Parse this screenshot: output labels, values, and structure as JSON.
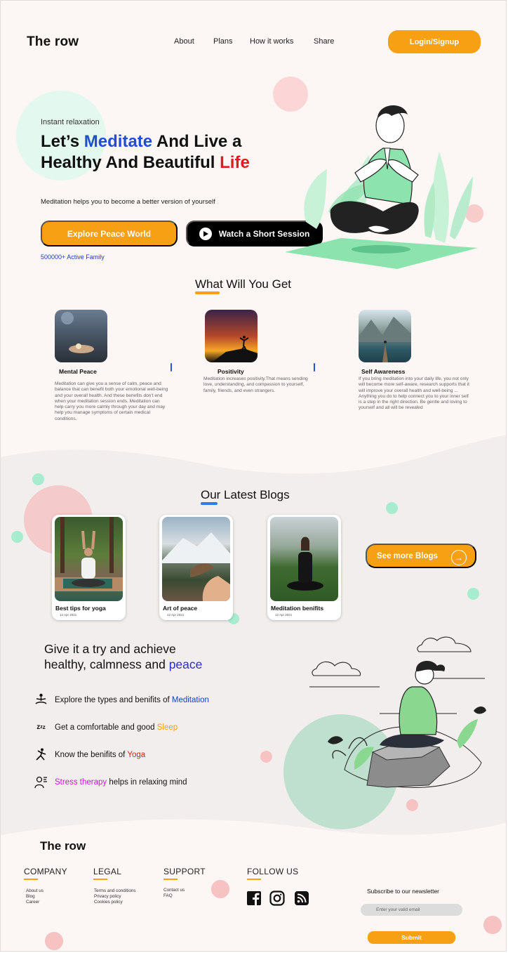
{
  "nav": {
    "logo": "The row",
    "links": [
      "About",
      "Plans",
      "How it works",
      "Share"
    ],
    "login_label": "Login/Signup"
  },
  "hero": {
    "eyebrow": "Instant relaxation",
    "title_parts": [
      "Let’s ",
      "Meditate",
      " And Live a Healthy And Beautiful ",
      "Life"
    ],
    "subtitle": "Meditation helps you to become a better version of yourself",
    "explore_label": "Explore Peace World",
    "watch_label": "Watch a Short Session",
    "active_family": "500000+ Active Family"
  },
  "features": {
    "title": "What Will You Get",
    "items": [
      {
        "title": "Mental Peace",
        "text": "Meditation can give you a sense of calm, peace and balance that can benefit both your emotional well-being and your overall health. And these benefits don't end when your meditation session ends. Meditation can help carry you more calmly through your day and may help you manage symptoms of certain medical conditions."
      },
      {
        "title": "Positivity",
        "text": "Meditation increases positivity.That means sending love, understanding, and compassion to yourself, family, friends, and even strangers."
      },
      {
        "title": "Self Awareness",
        "text": "If you bring meditation into your daily life, you not only will become more self-aware, research supports that it will improve your overall health and well-being ... Anything you do to help connect you to your inner self is a step in the right direction. Be gentle and loving to yourself and all will be revealed"
      }
    ]
  },
  "blogs": {
    "title": "Our Latest Blogs",
    "items": [
      {
        "title": "Best tips for yoga",
        "date": "12 Apr 2021"
      },
      {
        "title": "Art of peace",
        "date": "12 Apr 2021"
      },
      {
        "title": "Meditation benifits",
        "date": "12 Apr 2021"
      }
    ],
    "more_label": "See more Blogs"
  },
  "try": {
    "title_line1": "Give it a try and achieve",
    "title_line2_pre": "healthy, calmness and ",
    "title_line2_hl": "peace",
    "items": [
      {
        "icon": "meditation-icon",
        "pre": "Explore the types and benifits of ",
        "hl": "Meditation",
        "post": "",
        "color": "#1d3db8"
      },
      {
        "icon": "sleep-icon",
        "pre": "Get a comfortable and good ",
        "hl": "Sleep",
        "post": "",
        "color": "#f8a013"
      },
      {
        "icon": "yoga-icon",
        "pre": "Know the benifits of ",
        "hl": "Yoga",
        "post": "",
        "color": "#e01b1b"
      },
      {
        "icon": "stress-icon",
        "pre": "",
        "hl": "Stress therapy",
        "post": " helps in relaxing mind",
        "color": "#c21ecb"
      }
    ]
  },
  "footer": {
    "logo": "The row",
    "company": {
      "heading": "COMPANY",
      "links": [
        "About us",
        "Blog",
        "Career"
      ]
    },
    "legal": {
      "heading": "LEGAL",
      "links": [
        "Terms and conditions",
        "Privacy policy",
        "Cookies policy"
      ]
    },
    "support": {
      "heading": "SUPPORT",
      "links": [
        "Contact us",
        "FAQ"
      ]
    },
    "follow": {
      "heading": "FOLLOW US",
      "icons": [
        "facebook-icon",
        "instagram-icon",
        "rss-icon"
      ]
    },
    "newsletter": {
      "label": "Subscribe to our newsletter",
      "placeholder": "Enter your valid email",
      "submit_label": "Submit"
    }
  },
  "colors": {
    "accent": "#f8a013",
    "blue": "#1d3db8",
    "red": "#e01b1b",
    "purple": "#c21ecb",
    "mint": "#a8ecd0",
    "pink": "#f6c2c2",
    "background": "#fcf6f4"
  }
}
